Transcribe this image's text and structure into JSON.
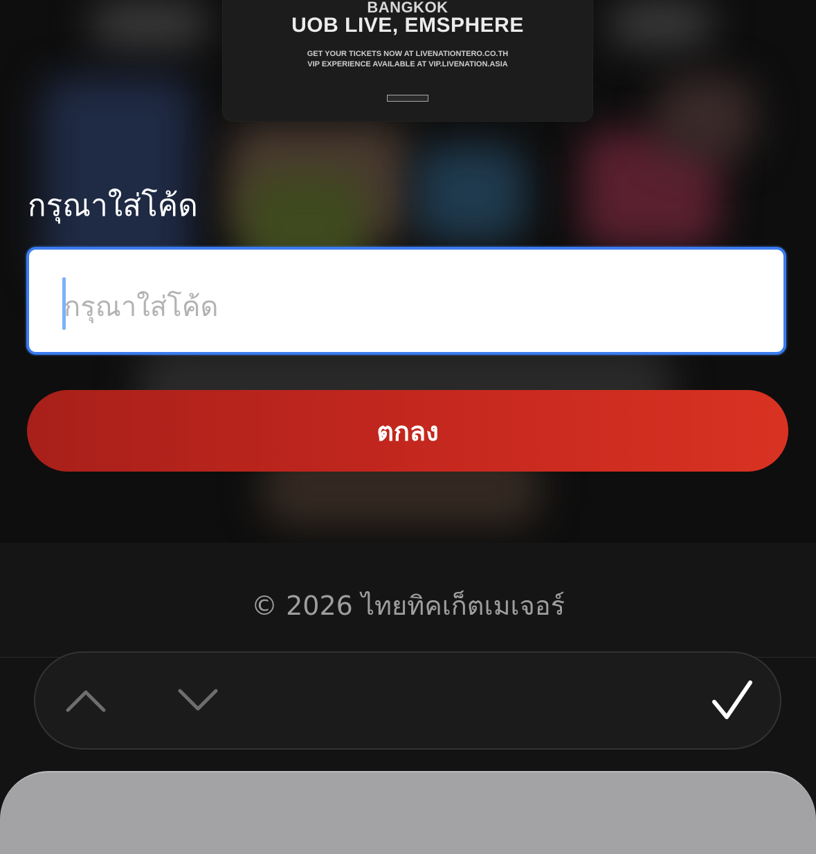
{
  "poster": {
    "city": "BANGKOK",
    "venue": "UOB LIVE, EMSPHERE",
    "line1": "GET YOUR TICKETS NOW AT LIVENATIONTERO.CO.TH",
    "line2": "VIP EXPERIENCE AVAILABLE AT VIP.LIVENATION.ASIA"
  },
  "form": {
    "title": "กรุณาใส่โค้ด",
    "code_placeholder": "กรุณาใส่โค้ด",
    "code_value": "",
    "submit_label": "ตกลง"
  },
  "footer": {
    "copyright": "© 2026 ไทยทิคเก็ตเมเจอร์"
  },
  "keyboard_toolbar": {
    "prev_icon": "chevron-up-icon",
    "next_icon": "chevron-down-icon",
    "done_icon": "checkmark-icon"
  },
  "colors": {
    "accent": "#3b7cf0",
    "button_red": "#c3271e",
    "background": "#0b0b0b"
  }
}
